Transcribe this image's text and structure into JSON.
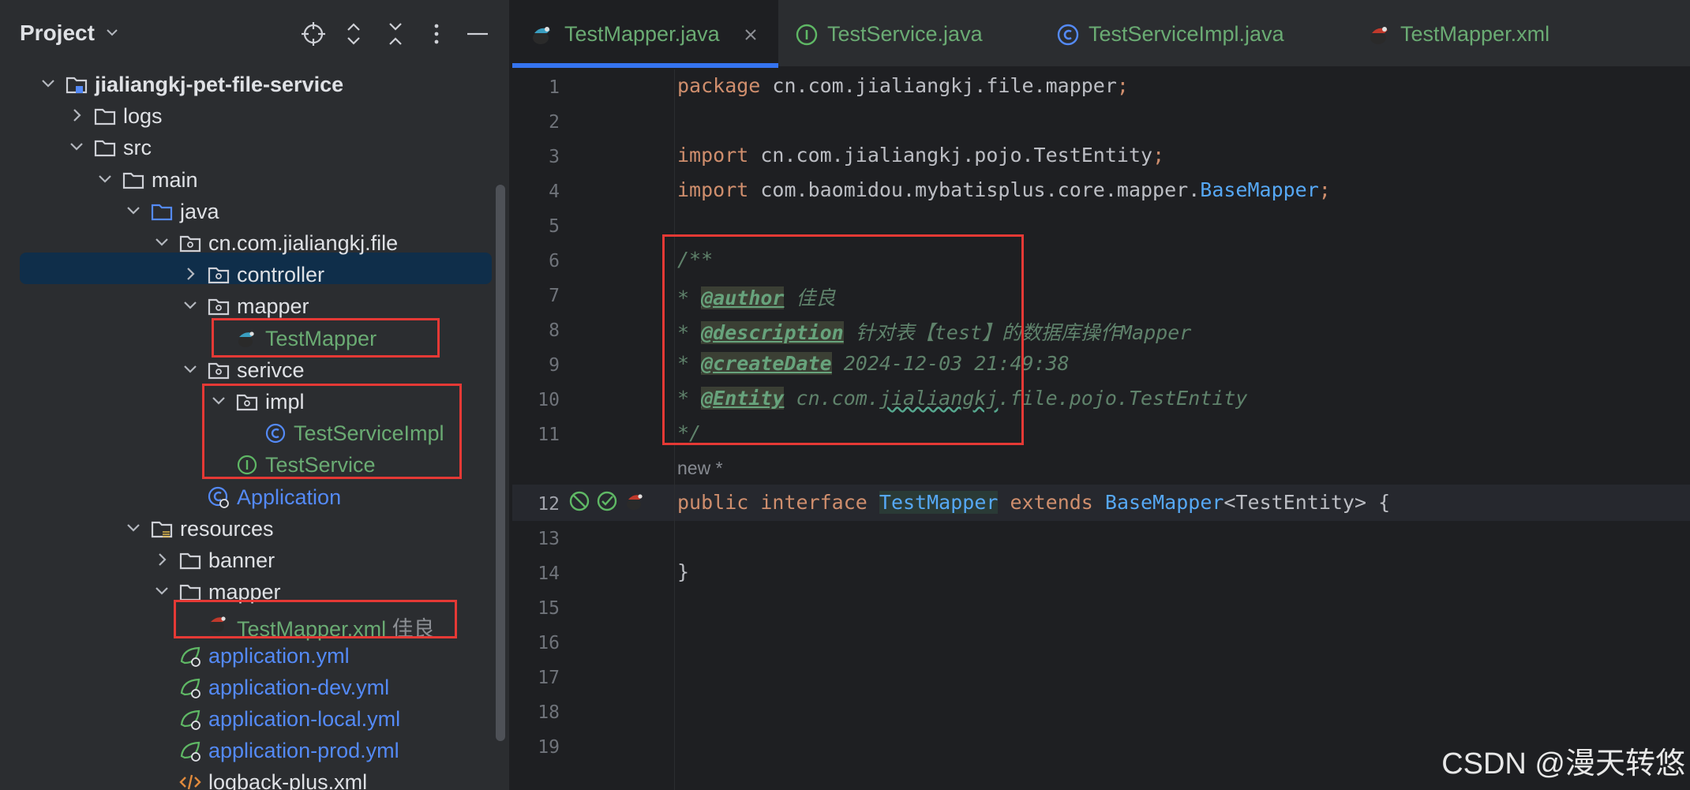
{
  "project_panel": {
    "title": "Project",
    "tree": [
      {
        "label": "jialiangkj-pet-file-service",
        "level": 0,
        "expanded": true,
        "icon": "module-folder-icon"
      },
      {
        "label": "logs",
        "level": 1,
        "expanded": false,
        "icon": "folder-icon"
      },
      {
        "label": "src",
        "level": 1,
        "expanded": true,
        "icon": "folder-icon"
      },
      {
        "label": "main",
        "level": 2,
        "expanded": true,
        "icon": "folder-icon"
      },
      {
        "label": "java",
        "level": 3,
        "expanded": true,
        "icon": "source-folder-icon"
      },
      {
        "label": "cn.com.jialiangkj.file",
        "level": 4,
        "expanded": true,
        "icon": "package-icon"
      },
      {
        "label": "controller",
        "level": 5,
        "expanded": false,
        "icon": "package-icon"
      },
      {
        "label": "mapper",
        "level": 5,
        "expanded": true,
        "icon": "package-icon"
      },
      {
        "label": "TestMapper",
        "level": 6,
        "icon": "mybatis-mapper-icon",
        "selected": true
      },
      {
        "label": "serivce",
        "level": 5,
        "expanded": true,
        "icon": "package-icon"
      },
      {
        "label": "impl",
        "level": 6,
        "expanded": true,
        "icon": "package-icon"
      },
      {
        "label": "TestServiceImpl",
        "level": 7,
        "icon": "class-icon"
      },
      {
        "label": "TestService",
        "level": 6,
        "icon": "interface-icon"
      },
      {
        "label": "Application",
        "level": 5,
        "icon": "spring-boot-class-icon"
      },
      {
        "label": "resources",
        "level": 3,
        "expanded": true,
        "icon": "resources-folder-icon"
      },
      {
        "label": "banner",
        "level": 4,
        "expanded": false,
        "icon": "folder-icon"
      },
      {
        "label": "mapper",
        "level": 4,
        "expanded": true,
        "icon": "folder-icon"
      },
      {
        "label": "TestMapper.xml",
        "sublabel": "佳良",
        "level": 5,
        "icon": "mybatis-xml-icon"
      },
      {
        "label": "application.yml",
        "level": 4,
        "icon": "spring-yml-icon"
      },
      {
        "label": "application-dev.yml",
        "level": 4,
        "icon": "spring-yml-icon"
      },
      {
        "label": "application-local.yml",
        "level": 4,
        "icon": "spring-yml-icon"
      },
      {
        "label": "application-prod.yml",
        "level": 4,
        "icon": "spring-yml-icon"
      },
      {
        "label": "logback-plus.xml",
        "level": 4,
        "icon": "xml-icon"
      }
    ]
  },
  "tabs": [
    {
      "label": "TestMapper.java",
      "icon": "mybatis-mapper-icon",
      "active": true
    },
    {
      "label": "TestService.java",
      "icon": "interface-icon"
    },
    {
      "label": "TestServiceImpl.java",
      "icon": "class-icon"
    },
    {
      "label": "TestMapper.xml",
      "icon": "mybatis-xml-icon"
    }
  ],
  "editor": {
    "line_numbers": [
      "1",
      "2",
      "3",
      "4",
      "5",
      "6",
      "7",
      "8",
      "9",
      "10",
      "11",
      "12",
      "13",
      "14",
      "15",
      "16",
      "17",
      "18",
      "19"
    ],
    "current_line": "12",
    "inlay_hint": "new *",
    "lines": {
      "l1": {
        "kw": "package",
        "rest": " cn.com.jialiangkj.file.mapper",
        "semi": ";"
      },
      "l3": {
        "kw": "import",
        "rest": " cn.com.jialiangkj.pojo.TestEntity",
        "semi": ";"
      },
      "l4": {
        "kw": "import",
        "rest": " com.baomidou.mybatisplus.core.mapper.",
        "type": "BaseMapper",
        "semi": ";"
      },
      "l6": "/**",
      "l7": {
        "star": "* ",
        "tag": "@author",
        "text": " 佳良"
      },
      "l8": {
        "star": "* ",
        "tag": "@description",
        "text": " 针对表【test】的数据库操作Mapper"
      },
      "l9": {
        "star": "* ",
        "tag": "@createDate",
        "text": " 2024-12-03 21:49:38"
      },
      "l10": {
        "star": "* ",
        "tag": "@Entity",
        "text_a": " cn.com.",
        "text_wavy": "jialiangkj",
        "text_b": ".file.pojo.TestEntity"
      },
      "l11": "*/",
      "l12": {
        "kw1": "public",
        "kw2": "interface",
        "name": "TestMapper",
        "kw3": "extends",
        "type": "BaseMapper",
        "generic": "<TestEntity> {"
      },
      "l14": "}"
    }
  },
  "watermark": "CSDN @漫天转悠"
}
